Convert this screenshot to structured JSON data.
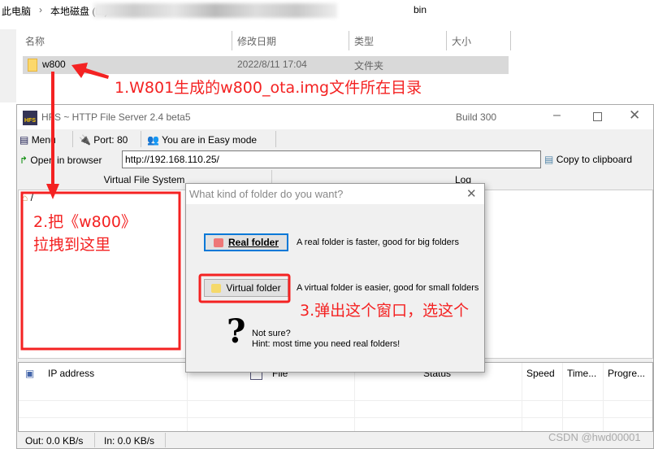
{
  "explorer": {
    "breadcrumb": [
      "此电脑",
      "本地磁盘 (E:)",
      "bin"
    ],
    "columns": [
      "名称",
      "修改日期",
      "类型",
      "大小"
    ],
    "rows": [
      {
        "name": "w800",
        "date": "2022/8/11 17:04",
        "type": "文件夹",
        "size": ""
      }
    ]
  },
  "hfs": {
    "title": "HFS ~ HTTP File Server 2.4 beta5",
    "build": "Build 300",
    "toolbar": {
      "menu": "Menu",
      "port": "Port: 80",
      "mode": "You are in Easy mode"
    },
    "open_browser": "Open in browser",
    "url": "http://192.168.110.25/",
    "copy": "Copy to clipboard",
    "tabs": [
      "Virtual File System",
      "Log"
    ],
    "root": "/",
    "connections_columns": [
      "IP address",
      "File",
      "Status",
      "Speed",
      "Time...",
      "Progre..."
    ],
    "status": {
      "out": "Out: 0.0 KB/s",
      "in": "In: 0.0 KB/s"
    }
  },
  "dialog": {
    "title": "What kind of folder do you want?",
    "real_button": "Real folder",
    "real_desc": "A real folder is faster, good for big folders",
    "virtual_button": "Virtual folder",
    "virtual_desc": "A virtual folder is easier, good for small folders",
    "not_sure": "Not sure?",
    "hint": "Hint: most time you need real folders!"
  },
  "annotations": {
    "a1": "1.W801生成的w800_ota.img文件所在目录",
    "a2_line1": "2.把《w800》",
    "a2_line2": "拉拽到这里",
    "a3": "3.弹出这个窗口，选这个",
    "color": "#f42222"
  },
  "watermark": "CSDN @hwd00001"
}
